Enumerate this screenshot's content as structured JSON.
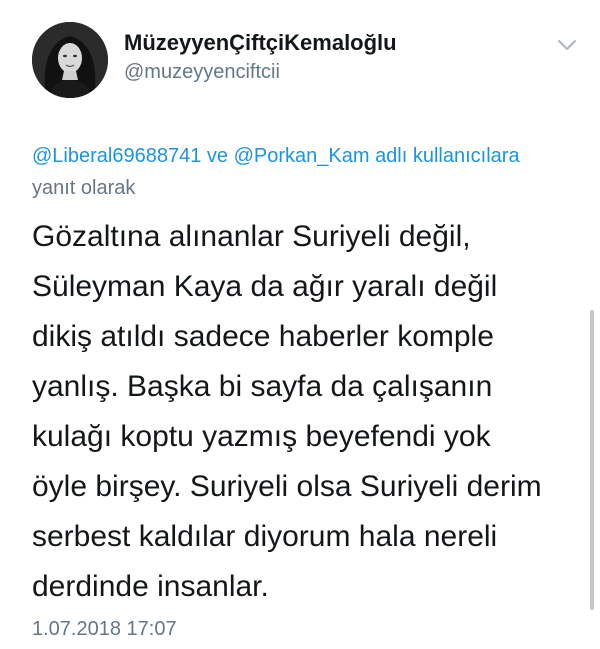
{
  "header": {
    "display_name": "MüzeyyenÇiftçiKemaloğlu",
    "handle": "@muzeyyenciftcii",
    "avatar_icon": "profile-photo",
    "menu_icon": "chevron-down-icon"
  },
  "reply_context": {
    "mention_1": "@Liberal69688741",
    "connector": "ve",
    "mention_2": "@Porkan_Kam",
    "suffix_link": "adlı kullanıcılara",
    "suffix_text": "yanıt olarak"
  },
  "tweet": {
    "text": "Gözaltına alınanlar Suriyeli değil,\nSüleyman Kaya da ağır yaralı değil\ndikiş atıldı sadece haberler komple\nyanlış. Başka bi sayfa da çalışanın\nkulağı koptu yazmış beyefendi yok\nöyle birşey. Suriyeli olsa Suriyeli derim\nserbest kaldılar diyorum hala nereli\nderdinde insanlar.",
    "timestamp": "1.07.2018 17:07"
  },
  "colors": {
    "link": "#1b95e0",
    "secondary_text": "#657786",
    "primary_text": "#14171a"
  }
}
